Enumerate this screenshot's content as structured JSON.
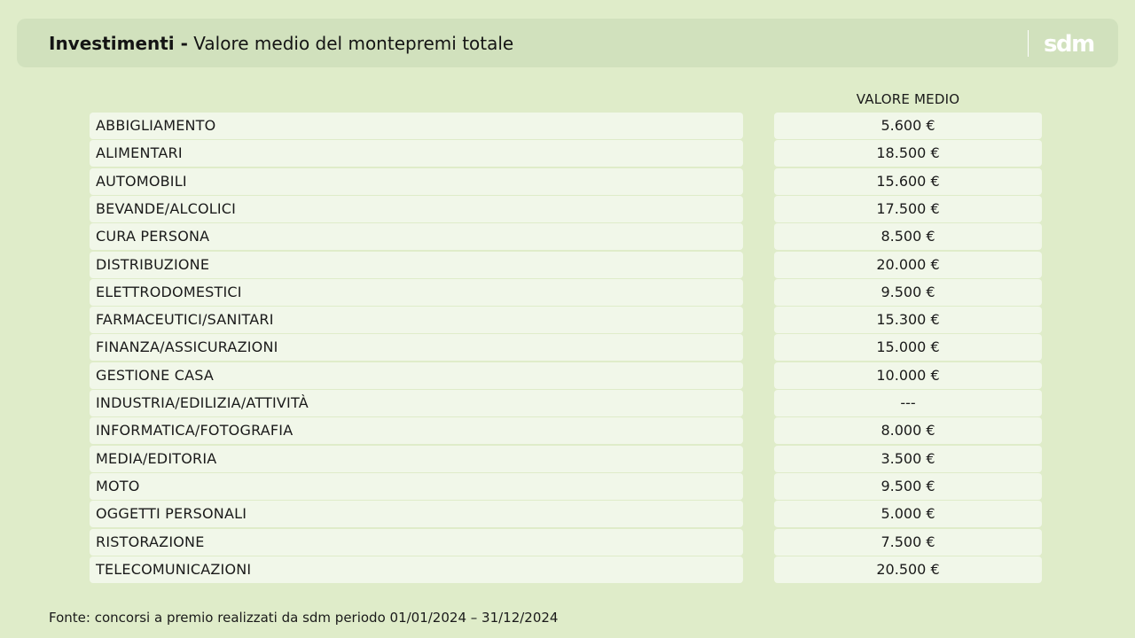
{
  "header": {
    "title_bold": "Investimenti -",
    "title_rest": "Valore medio del montepremi totale",
    "logo_text": "sdm"
  },
  "table": {
    "value_column_header": "VALORE MEDIO",
    "rows": [
      {
        "label": "ABBIGLIAMENTO",
        "value": "5.600 €"
      },
      {
        "label": "ALIMENTARI",
        "value": "18.500 €"
      },
      {
        "label": "AUTOMOBILI",
        "value": "15.600 €"
      },
      {
        "label": "BEVANDE/ALCOLICI",
        "value": "17.500 €"
      },
      {
        "label": "CURA PERSONA",
        "value": "8.500 €"
      },
      {
        "label": "DISTRIBUZIONE",
        "value": "20.000 €"
      },
      {
        "label": "ELETTRODOMESTICI",
        "value": "9.500 €"
      },
      {
        "label": "FARMACEUTICI/SANITARI",
        "value": "15.300 €"
      },
      {
        "label": "FINANZA/ASSICURAZIONI",
        "value": "15.000 €"
      },
      {
        "label": "GESTIONE CASA",
        "value": "10.000 €"
      },
      {
        "label": "INDUSTRIA/EDILIZIA/ATTIVITÀ",
        "value": "---"
      },
      {
        "label": "INFORMATICA/FOTOGRAFIA",
        "value": "8.000 €"
      },
      {
        "label": "MEDIA/EDITORIA",
        "value": "3.500 €"
      },
      {
        "label": "MOTO",
        "value": "9.500 €"
      },
      {
        "label": "OGGETTI PERSONALI",
        "value": "5.000 €"
      },
      {
        "label": "RISTORAZIONE",
        "value": "7.500 €"
      },
      {
        "label": "TELECOMUNICAZIONI",
        "value": "20.500 €"
      }
    ]
  },
  "footer": {
    "source": "Fonte: concorsi a premio realizzati da sdm periodo 01/01/2024 – 31/12/2024"
  },
  "colors": {
    "background": "#dfecc9",
    "header_band": "#d1e1bd",
    "row_cell": "#f1f7e9",
    "logo": "#ffffff"
  }
}
